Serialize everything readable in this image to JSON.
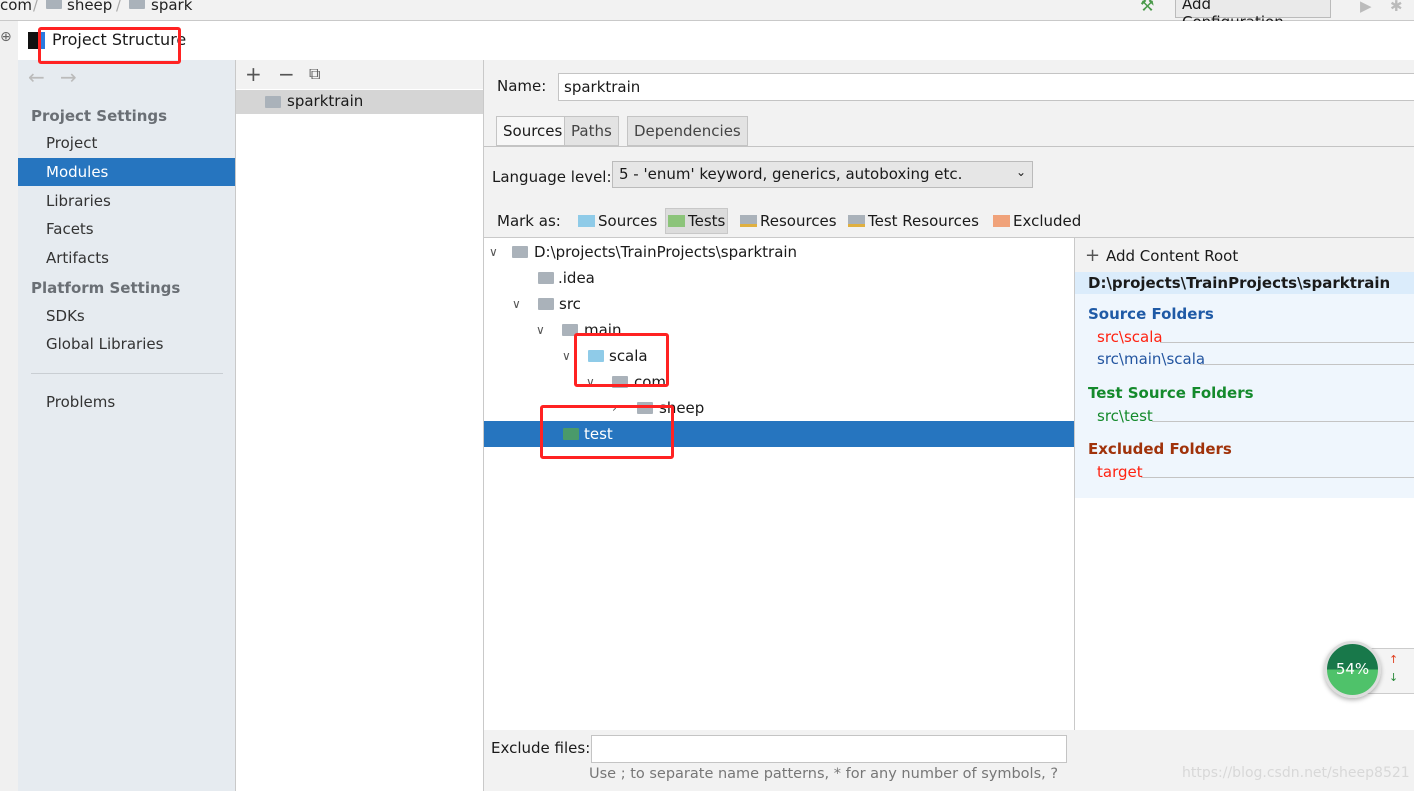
{
  "ide": {
    "breadcrumb": [
      "com",
      "sheep",
      "spark"
    ],
    "add_configuration": "Add Configuration..."
  },
  "dialog": {
    "title": "Project Structure"
  },
  "sidebar": {
    "project_settings": "Project Settings",
    "items1": [
      "Project",
      "Modules",
      "Libraries",
      "Facets",
      "Artifacts"
    ],
    "platform_settings": "Platform Settings",
    "items2": [
      "SDKs",
      "Global Libraries"
    ],
    "problems": "Problems",
    "selected": "Modules"
  },
  "modules": {
    "items": [
      "sparktrain"
    ]
  },
  "main": {
    "name_label": "Name:",
    "name_value": "sparktrain",
    "tabs": [
      "Sources",
      "Paths",
      "Dependencies"
    ],
    "language_level_label": "Language level:",
    "language_level_value": "5 - 'enum' keyword, generics, autoboxing etc.",
    "mark_as_label": "Mark as:",
    "mark_as": [
      {
        "label": "Sources",
        "color": "#8fcbe8"
      },
      {
        "label": "Tests",
        "color": "#8cc47a"
      },
      {
        "label": "Resources",
        "color": "#aab2ba"
      },
      {
        "label": "Test Resources",
        "color": "#aab2ba"
      },
      {
        "label": "Excluded",
        "color": "#f0a27a"
      }
    ],
    "tree": [
      "D:\\projects\\TrainProjects\\sparktrain",
      ".idea",
      "src",
      "main",
      "scala",
      "com",
      "sheep",
      "test"
    ],
    "exclude_files_label": "Exclude files:",
    "exclude_files_value": "",
    "exclude_hint": "Use ; to separate name patterns, * for any number of symbols, ?"
  },
  "content_root": {
    "add": "Add Content Root",
    "path": "D:\\projects\\TrainProjects\\sparktrain",
    "source_folders": "Source Folders",
    "sources": [
      "src\\scala",
      "src\\main\\scala"
    ],
    "test_source_folders": "Test Source Folders",
    "tests": [
      "src\\test"
    ],
    "excluded_folders": "Excluded Folders",
    "excluded": [
      "target"
    ]
  },
  "widget": {
    "percent": "54%"
  },
  "watermark": "https://blog.csdn.net/sheep8521"
}
